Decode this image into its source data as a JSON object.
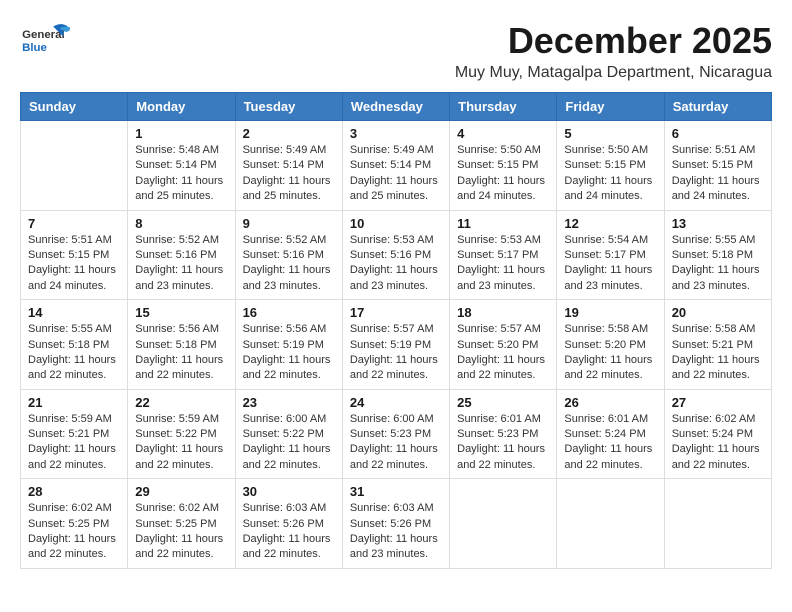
{
  "logo": {
    "general": "General",
    "blue": "Blue"
  },
  "title": "December 2025",
  "subtitle": "Muy Muy, Matagalpa Department, Nicaragua",
  "headers": [
    "Sunday",
    "Monday",
    "Tuesday",
    "Wednesday",
    "Thursday",
    "Friday",
    "Saturday"
  ],
  "weeks": [
    [
      {
        "day": "",
        "info": ""
      },
      {
        "day": "1",
        "info": "Sunrise: 5:48 AM\nSunset: 5:14 PM\nDaylight: 11 hours\nand 25 minutes."
      },
      {
        "day": "2",
        "info": "Sunrise: 5:49 AM\nSunset: 5:14 PM\nDaylight: 11 hours\nand 25 minutes."
      },
      {
        "day": "3",
        "info": "Sunrise: 5:49 AM\nSunset: 5:14 PM\nDaylight: 11 hours\nand 25 minutes."
      },
      {
        "day": "4",
        "info": "Sunrise: 5:50 AM\nSunset: 5:15 PM\nDaylight: 11 hours\nand 24 minutes."
      },
      {
        "day": "5",
        "info": "Sunrise: 5:50 AM\nSunset: 5:15 PM\nDaylight: 11 hours\nand 24 minutes."
      },
      {
        "day": "6",
        "info": "Sunrise: 5:51 AM\nSunset: 5:15 PM\nDaylight: 11 hours\nand 24 minutes."
      }
    ],
    [
      {
        "day": "7",
        "info": "Sunrise: 5:51 AM\nSunset: 5:15 PM\nDaylight: 11 hours\nand 24 minutes."
      },
      {
        "day": "8",
        "info": "Sunrise: 5:52 AM\nSunset: 5:16 PM\nDaylight: 11 hours\nand 23 minutes."
      },
      {
        "day": "9",
        "info": "Sunrise: 5:52 AM\nSunset: 5:16 PM\nDaylight: 11 hours\nand 23 minutes."
      },
      {
        "day": "10",
        "info": "Sunrise: 5:53 AM\nSunset: 5:16 PM\nDaylight: 11 hours\nand 23 minutes."
      },
      {
        "day": "11",
        "info": "Sunrise: 5:53 AM\nSunset: 5:17 PM\nDaylight: 11 hours\nand 23 minutes."
      },
      {
        "day": "12",
        "info": "Sunrise: 5:54 AM\nSunset: 5:17 PM\nDaylight: 11 hours\nand 23 minutes."
      },
      {
        "day": "13",
        "info": "Sunrise: 5:55 AM\nSunset: 5:18 PM\nDaylight: 11 hours\nand 23 minutes."
      }
    ],
    [
      {
        "day": "14",
        "info": "Sunrise: 5:55 AM\nSunset: 5:18 PM\nDaylight: 11 hours\nand 22 minutes."
      },
      {
        "day": "15",
        "info": "Sunrise: 5:56 AM\nSunset: 5:18 PM\nDaylight: 11 hours\nand 22 minutes."
      },
      {
        "day": "16",
        "info": "Sunrise: 5:56 AM\nSunset: 5:19 PM\nDaylight: 11 hours\nand 22 minutes."
      },
      {
        "day": "17",
        "info": "Sunrise: 5:57 AM\nSunset: 5:19 PM\nDaylight: 11 hours\nand 22 minutes."
      },
      {
        "day": "18",
        "info": "Sunrise: 5:57 AM\nSunset: 5:20 PM\nDaylight: 11 hours\nand 22 minutes."
      },
      {
        "day": "19",
        "info": "Sunrise: 5:58 AM\nSunset: 5:20 PM\nDaylight: 11 hours\nand 22 minutes."
      },
      {
        "day": "20",
        "info": "Sunrise: 5:58 AM\nSunset: 5:21 PM\nDaylight: 11 hours\nand 22 minutes."
      }
    ],
    [
      {
        "day": "21",
        "info": "Sunrise: 5:59 AM\nSunset: 5:21 PM\nDaylight: 11 hours\nand 22 minutes."
      },
      {
        "day": "22",
        "info": "Sunrise: 5:59 AM\nSunset: 5:22 PM\nDaylight: 11 hours\nand 22 minutes."
      },
      {
        "day": "23",
        "info": "Sunrise: 6:00 AM\nSunset: 5:22 PM\nDaylight: 11 hours\nand 22 minutes."
      },
      {
        "day": "24",
        "info": "Sunrise: 6:00 AM\nSunset: 5:23 PM\nDaylight: 11 hours\nand 22 minutes."
      },
      {
        "day": "25",
        "info": "Sunrise: 6:01 AM\nSunset: 5:23 PM\nDaylight: 11 hours\nand 22 minutes."
      },
      {
        "day": "26",
        "info": "Sunrise: 6:01 AM\nSunset: 5:24 PM\nDaylight: 11 hours\nand 22 minutes."
      },
      {
        "day": "27",
        "info": "Sunrise: 6:02 AM\nSunset: 5:24 PM\nDaylight: 11 hours\nand 22 minutes."
      }
    ],
    [
      {
        "day": "28",
        "info": "Sunrise: 6:02 AM\nSunset: 5:25 PM\nDaylight: 11 hours\nand 22 minutes."
      },
      {
        "day": "29",
        "info": "Sunrise: 6:02 AM\nSunset: 5:25 PM\nDaylight: 11 hours\nand 22 minutes."
      },
      {
        "day": "30",
        "info": "Sunrise: 6:03 AM\nSunset: 5:26 PM\nDaylight: 11 hours\nand 22 minutes."
      },
      {
        "day": "31",
        "info": "Sunrise: 6:03 AM\nSunset: 5:26 PM\nDaylight: 11 hours\nand 23 minutes."
      },
      {
        "day": "",
        "info": ""
      },
      {
        "day": "",
        "info": ""
      },
      {
        "day": "",
        "info": ""
      }
    ]
  ]
}
